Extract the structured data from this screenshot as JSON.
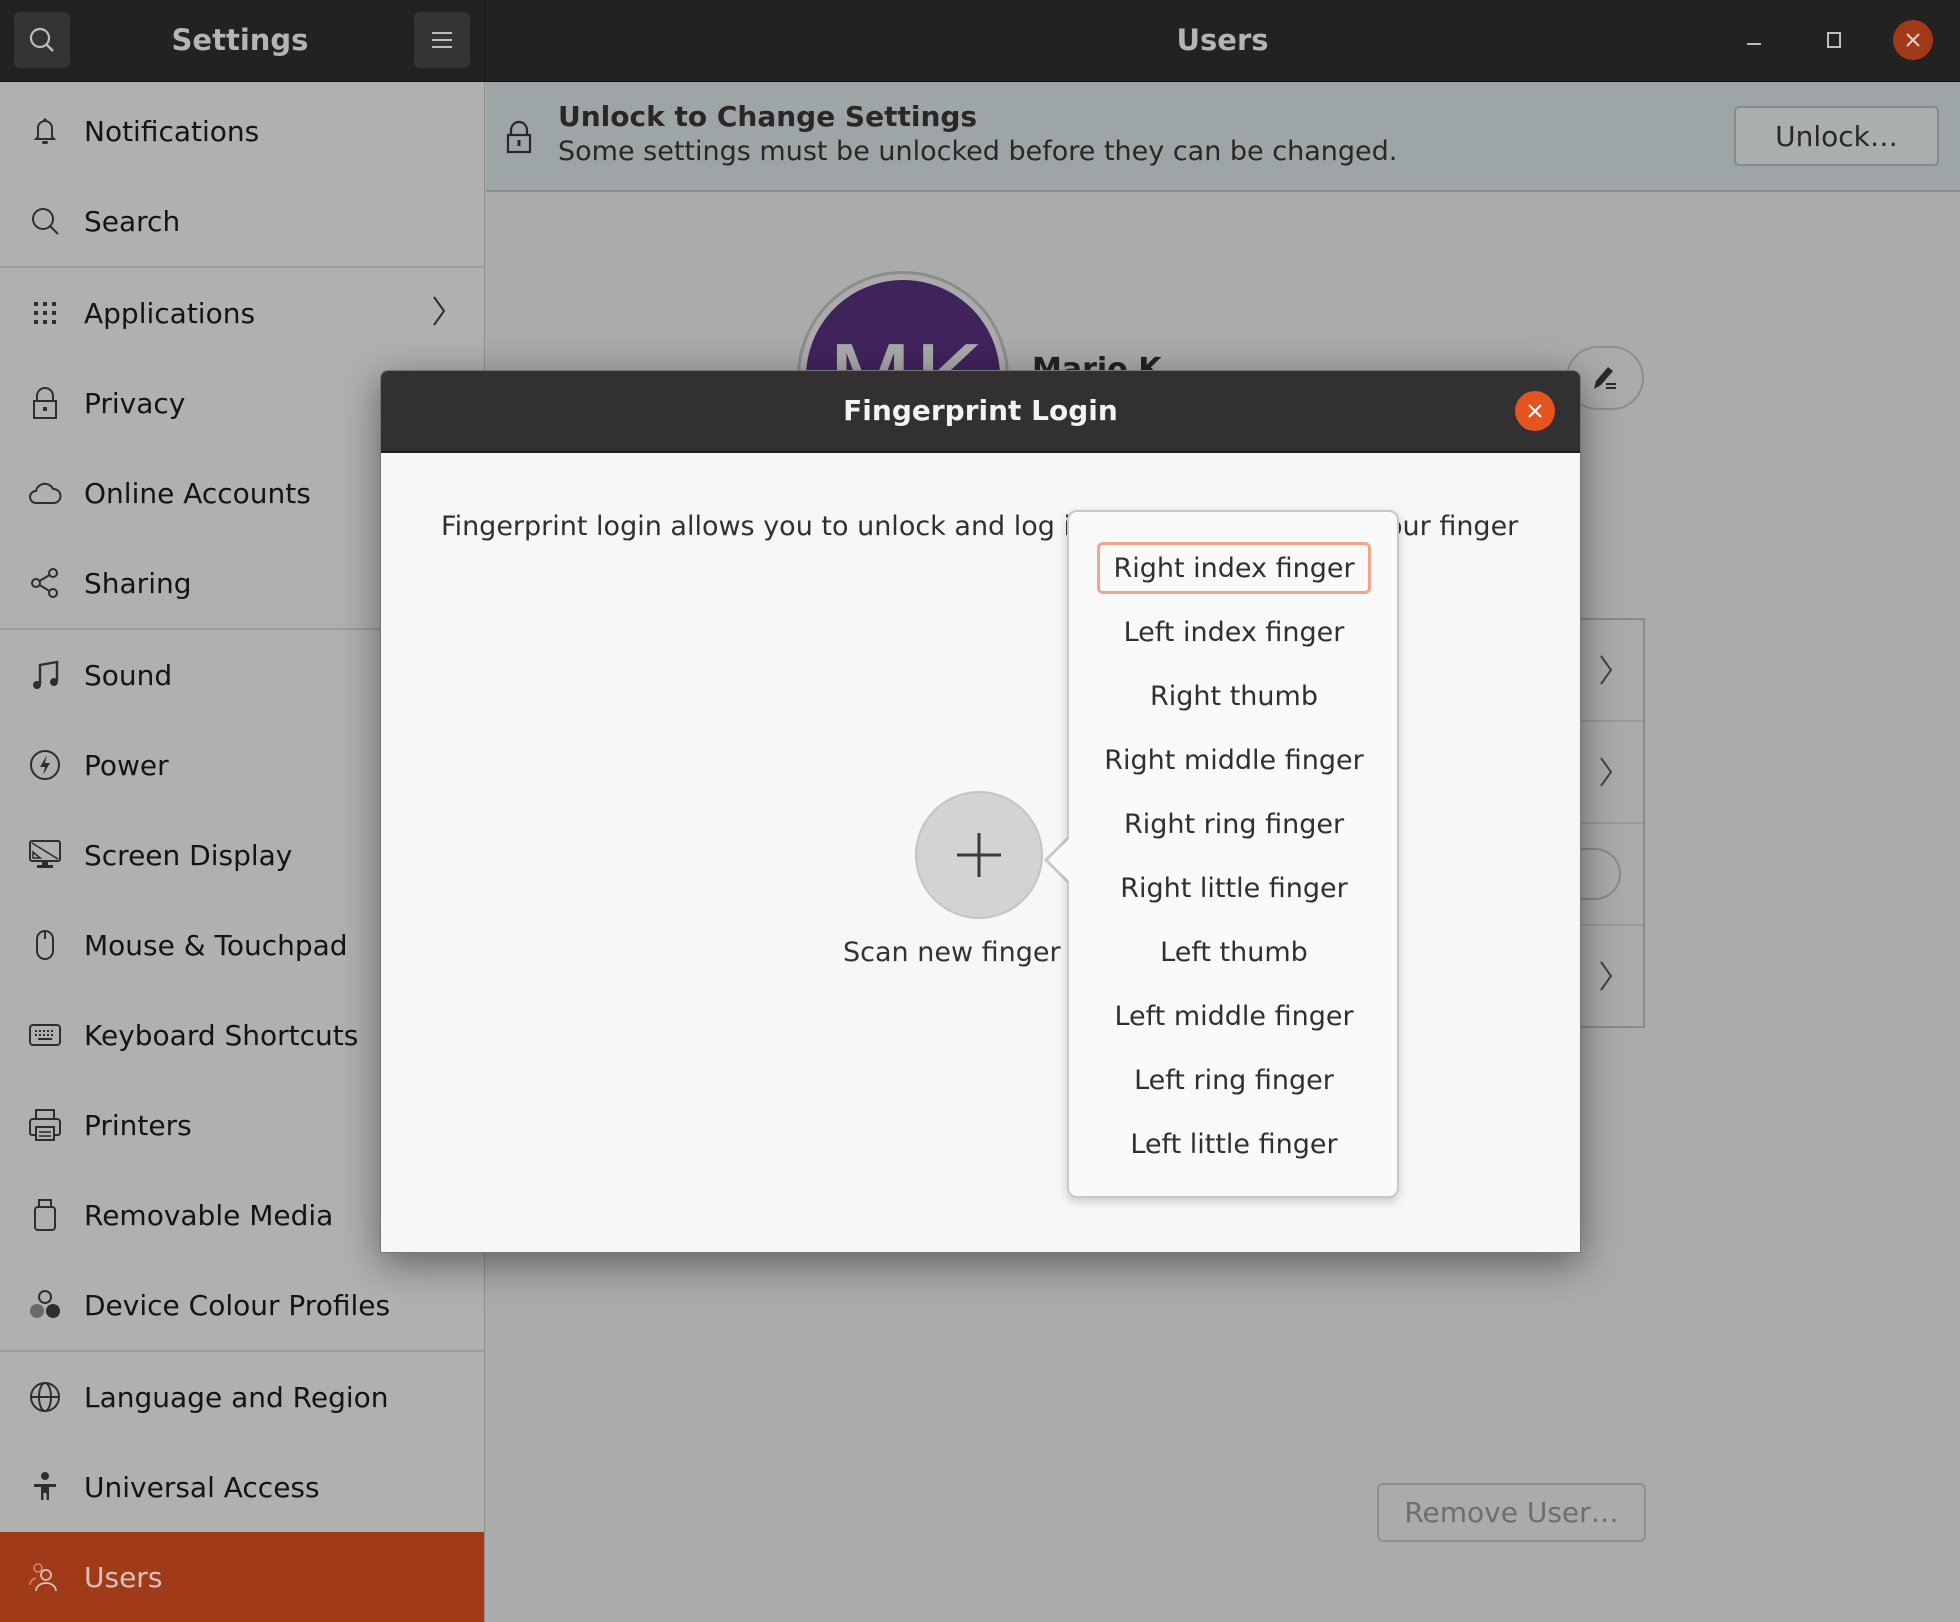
{
  "header": {
    "app_title": "Settings",
    "page_title": "Users",
    "search_icon": "search-icon",
    "menu_icon": "hamburger-menu-icon",
    "window_controls": [
      "minimize",
      "maximize",
      "close"
    ]
  },
  "sidebar": {
    "items": [
      {
        "label": "Notifications",
        "icon": "bell-icon"
      },
      {
        "label": "Search",
        "icon": "search-icon"
      },
      {
        "label": "Applications",
        "icon": "app-grid-icon",
        "has_submenu": true
      },
      {
        "label": "Privacy",
        "icon": "lock-icon"
      },
      {
        "label": "Online Accounts",
        "icon": "cloud-icon"
      },
      {
        "label": "Sharing",
        "icon": "share-icon"
      },
      {
        "label": "Sound",
        "icon": "music-note-icon"
      },
      {
        "label": "Power",
        "icon": "power-icon"
      },
      {
        "label": "Screen Display",
        "icon": "display-icon"
      },
      {
        "label": "Mouse & Touchpad",
        "icon": "mouse-icon"
      },
      {
        "label": "Keyboard Shortcuts",
        "icon": "keyboard-icon"
      },
      {
        "label": "Printers",
        "icon": "printer-icon"
      },
      {
        "label": "Removable Media",
        "icon": "usb-drive-icon"
      },
      {
        "label": "Device Colour Profiles",
        "icon": "colour-profiles-icon"
      },
      {
        "label": "Language and Region",
        "icon": "globe-icon"
      },
      {
        "label": "Universal Access",
        "icon": "accessibility-icon"
      },
      {
        "label": "Users",
        "icon": "users-icon",
        "active": true
      }
    ]
  },
  "banner": {
    "title": "Unlock to Change Settings",
    "subtitle": "Some settings must be unlocked before they can be changed.",
    "unlock_button": "Unlock…"
  },
  "user": {
    "avatar_initials": "MK",
    "name_partial": "Mario K"
  },
  "main": {
    "remove_user_button": "Remove User…"
  },
  "dialog": {
    "title": "Fingerprint Login",
    "description_left": "Fingerprint login allows you to unlock and log in",
    "description_right": "our finger",
    "scan_label": "Scan new fingerprint",
    "finger_options": [
      "Right index finger",
      "Left index finger",
      "Right thumb",
      "Right middle finger",
      "Right ring finger",
      "Right little finger",
      "Left thumb",
      "Left middle finger",
      "Left ring finger",
      "Left little finger"
    ],
    "focused_option": "Right index finger"
  },
  "colors": {
    "accent": "#a03a19",
    "close_button": "#e5531e",
    "focus_ring": "#f0a58a",
    "avatar_bg": "#41235c"
  }
}
